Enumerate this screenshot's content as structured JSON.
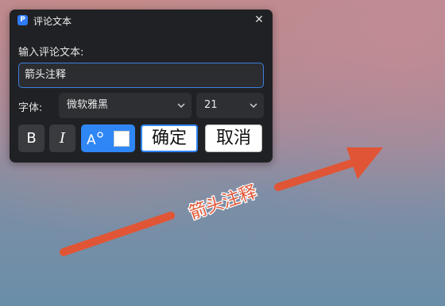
{
  "dialog": {
    "title": "评论文本",
    "app_icon_letter": "P",
    "close_glyph": "✕",
    "input_label": "输入评论文本:",
    "input_value": "箭头注释",
    "font_label": "字体:",
    "font_family_value": "微软雅黑",
    "font_size_value": "21",
    "bold_label": "B",
    "italic_label": "I",
    "ok_label": "确定",
    "cancel_label": "取消",
    "text_color": "#ffffff",
    "accent_color": "#2f86f5"
  },
  "annotation": {
    "text": "箭头注释",
    "arrow_color": "#e05535",
    "text_color": "#e05535"
  }
}
